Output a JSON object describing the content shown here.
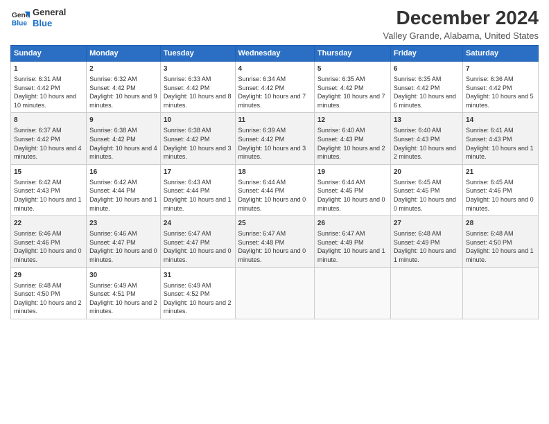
{
  "logo": {
    "line1": "General",
    "line2": "Blue"
  },
  "title": "December 2024",
  "subtitle": "Valley Grande, Alabama, United States",
  "headers": [
    "Sunday",
    "Monday",
    "Tuesday",
    "Wednesday",
    "Thursday",
    "Friday",
    "Saturday"
  ],
  "weeks": [
    [
      {
        "day": "1",
        "sunrise": "Sunrise: 6:31 AM",
        "sunset": "Sunset: 4:42 PM",
        "daylight": "Daylight: 10 hours and 10 minutes."
      },
      {
        "day": "2",
        "sunrise": "Sunrise: 6:32 AM",
        "sunset": "Sunset: 4:42 PM",
        "daylight": "Daylight: 10 hours and 9 minutes."
      },
      {
        "day": "3",
        "sunrise": "Sunrise: 6:33 AM",
        "sunset": "Sunset: 4:42 PM",
        "daylight": "Daylight: 10 hours and 8 minutes."
      },
      {
        "day": "4",
        "sunrise": "Sunrise: 6:34 AM",
        "sunset": "Sunset: 4:42 PM",
        "daylight": "Daylight: 10 hours and 7 minutes."
      },
      {
        "day": "5",
        "sunrise": "Sunrise: 6:35 AM",
        "sunset": "Sunset: 4:42 PM",
        "daylight": "Daylight: 10 hours and 7 minutes."
      },
      {
        "day": "6",
        "sunrise": "Sunrise: 6:35 AM",
        "sunset": "Sunset: 4:42 PM",
        "daylight": "Daylight: 10 hours and 6 minutes."
      },
      {
        "day": "7",
        "sunrise": "Sunrise: 6:36 AM",
        "sunset": "Sunset: 4:42 PM",
        "daylight": "Daylight: 10 hours and 5 minutes."
      }
    ],
    [
      {
        "day": "8",
        "sunrise": "Sunrise: 6:37 AM",
        "sunset": "Sunset: 4:42 PM",
        "daylight": "Daylight: 10 hours and 4 minutes."
      },
      {
        "day": "9",
        "sunrise": "Sunrise: 6:38 AM",
        "sunset": "Sunset: 4:42 PM",
        "daylight": "Daylight: 10 hours and 4 minutes."
      },
      {
        "day": "10",
        "sunrise": "Sunrise: 6:38 AM",
        "sunset": "Sunset: 4:42 PM",
        "daylight": "Daylight: 10 hours and 3 minutes."
      },
      {
        "day": "11",
        "sunrise": "Sunrise: 6:39 AM",
        "sunset": "Sunset: 4:42 PM",
        "daylight": "Daylight: 10 hours and 3 minutes."
      },
      {
        "day": "12",
        "sunrise": "Sunrise: 6:40 AM",
        "sunset": "Sunset: 4:43 PM",
        "daylight": "Daylight: 10 hours and 2 minutes."
      },
      {
        "day": "13",
        "sunrise": "Sunrise: 6:40 AM",
        "sunset": "Sunset: 4:43 PM",
        "daylight": "Daylight: 10 hours and 2 minutes."
      },
      {
        "day": "14",
        "sunrise": "Sunrise: 6:41 AM",
        "sunset": "Sunset: 4:43 PM",
        "daylight": "Daylight: 10 hours and 1 minute."
      }
    ],
    [
      {
        "day": "15",
        "sunrise": "Sunrise: 6:42 AM",
        "sunset": "Sunset: 4:43 PM",
        "daylight": "Daylight: 10 hours and 1 minute."
      },
      {
        "day": "16",
        "sunrise": "Sunrise: 6:42 AM",
        "sunset": "Sunset: 4:44 PM",
        "daylight": "Daylight: 10 hours and 1 minute."
      },
      {
        "day": "17",
        "sunrise": "Sunrise: 6:43 AM",
        "sunset": "Sunset: 4:44 PM",
        "daylight": "Daylight: 10 hours and 1 minute."
      },
      {
        "day": "18",
        "sunrise": "Sunrise: 6:44 AM",
        "sunset": "Sunset: 4:44 PM",
        "daylight": "Daylight: 10 hours and 0 minutes."
      },
      {
        "day": "19",
        "sunrise": "Sunrise: 6:44 AM",
        "sunset": "Sunset: 4:45 PM",
        "daylight": "Daylight: 10 hours and 0 minutes."
      },
      {
        "day": "20",
        "sunrise": "Sunrise: 6:45 AM",
        "sunset": "Sunset: 4:45 PM",
        "daylight": "Daylight: 10 hours and 0 minutes."
      },
      {
        "day": "21",
        "sunrise": "Sunrise: 6:45 AM",
        "sunset": "Sunset: 4:46 PM",
        "daylight": "Daylight: 10 hours and 0 minutes."
      }
    ],
    [
      {
        "day": "22",
        "sunrise": "Sunrise: 6:46 AM",
        "sunset": "Sunset: 4:46 PM",
        "daylight": "Daylight: 10 hours and 0 minutes."
      },
      {
        "day": "23",
        "sunrise": "Sunrise: 6:46 AM",
        "sunset": "Sunset: 4:47 PM",
        "daylight": "Daylight: 10 hours and 0 minutes."
      },
      {
        "day": "24",
        "sunrise": "Sunrise: 6:47 AM",
        "sunset": "Sunset: 4:47 PM",
        "daylight": "Daylight: 10 hours and 0 minutes."
      },
      {
        "day": "25",
        "sunrise": "Sunrise: 6:47 AM",
        "sunset": "Sunset: 4:48 PM",
        "daylight": "Daylight: 10 hours and 0 minutes."
      },
      {
        "day": "26",
        "sunrise": "Sunrise: 6:47 AM",
        "sunset": "Sunset: 4:49 PM",
        "daylight": "Daylight: 10 hours and 1 minute."
      },
      {
        "day": "27",
        "sunrise": "Sunrise: 6:48 AM",
        "sunset": "Sunset: 4:49 PM",
        "daylight": "Daylight: 10 hours and 1 minute."
      },
      {
        "day": "28",
        "sunrise": "Sunrise: 6:48 AM",
        "sunset": "Sunset: 4:50 PM",
        "daylight": "Daylight: 10 hours and 1 minute."
      }
    ],
    [
      {
        "day": "29",
        "sunrise": "Sunrise: 6:48 AM",
        "sunset": "Sunset: 4:50 PM",
        "daylight": "Daylight: 10 hours and 2 minutes."
      },
      {
        "day": "30",
        "sunrise": "Sunrise: 6:49 AM",
        "sunset": "Sunset: 4:51 PM",
        "daylight": "Daylight: 10 hours and 2 minutes."
      },
      {
        "day": "31",
        "sunrise": "Sunrise: 6:49 AM",
        "sunset": "Sunset: 4:52 PM",
        "daylight": "Daylight: 10 hours and 2 minutes."
      },
      null,
      null,
      null,
      null
    ]
  ]
}
